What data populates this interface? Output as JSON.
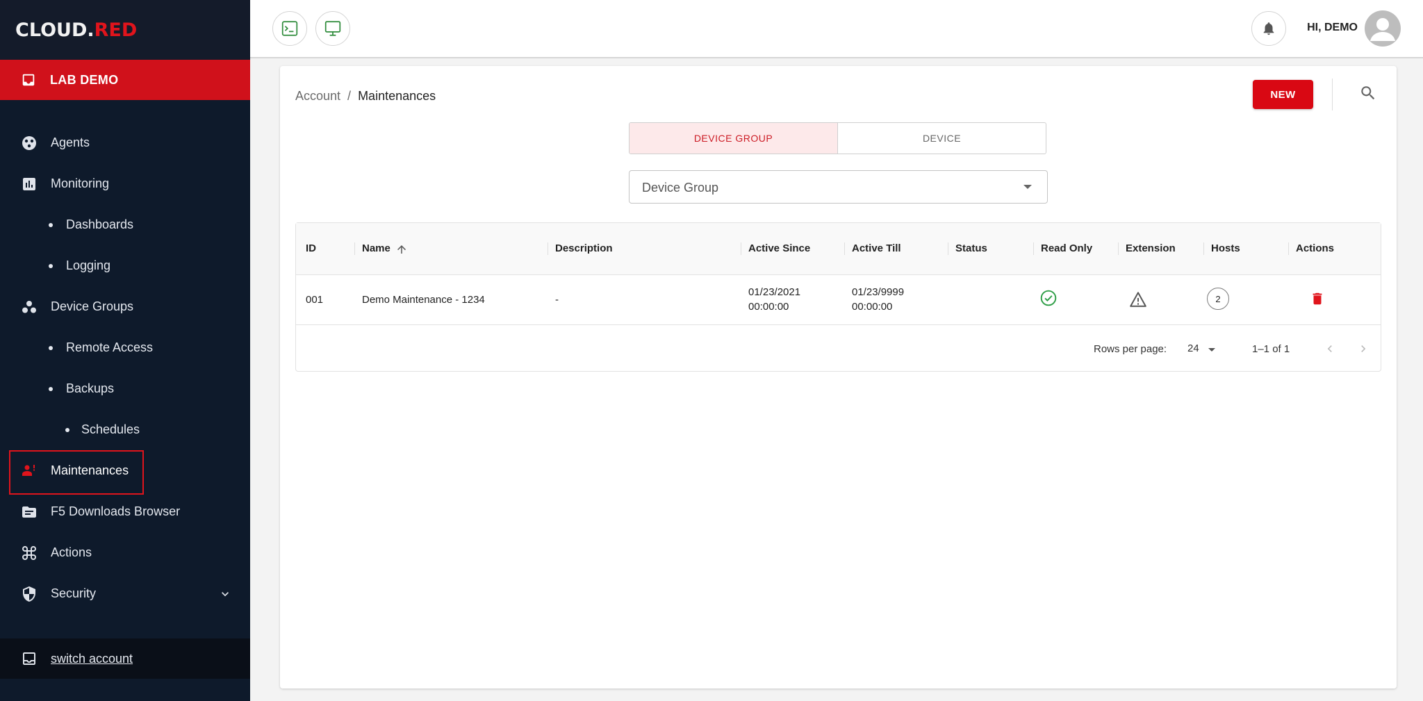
{
  "brand": {
    "logo_part1": "CL",
    "logo_o": "O",
    "logo_part2": "UD.",
    "logo_part3": "RED",
    "accent": "#d0111b"
  },
  "sidebar": {
    "account_label": "LAB DEMO",
    "items": [
      {
        "label": "Agents",
        "icon": "agents-icon",
        "level": 0
      },
      {
        "label": "Monitoring",
        "icon": "chart-icon",
        "level": 0
      },
      {
        "label": "Dashboards",
        "icon": "bullet",
        "level": 1
      },
      {
        "label": "Logging",
        "icon": "bullet",
        "level": 1
      },
      {
        "label": "Device Groups",
        "icon": "device-groups-icon",
        "level": 0
      },
      {
        "label": "Remote Access",
        "icon": "bullet",
        "level": 1
      },
      {
        "label": "Backups",
        "icon": "bullet",
        "level": 1
      },
      {
        "label": "Schedules",
        "icon": "bullet",
        "level": 2
      },
      {
        "label": "Maintenances",
        "icon": "maintenance-icon",
        "level": 0,
        "selected": true
      },
      {
        "label": "F5 Downloads Browser",
        "icon": "folder-icon",
        "level": 0
      },
      {
        "label": "Actions",
        "icon": "command-icon",
        "level": 0
      },
      {
        "label": "Security",
        "icon": "shield-icon",
        "level": 0,
        "expandable": true
      }
    ],
    "switch_account": "switch account"
  },
  "topbar": {
    "greeting": "HI, DEMO",
    "terminal_icon": "terminal-icon",
    "monitor_icon": "monitor-icon",
    "bell_icon": "bell-icon"
  },
  "main": {
    "breadcrumb": {
      "root": "Account",
      "separator": "/",
      "current": "Maintenances"
    },
    "new_label": "NEW",
    "tabs": [
      {
        "label": "DEVICE GROUP",
        "active": true
      },
      {
        "label": "DEVICE",
        "active": false
      }
    ],
    "select": {
      "value": "Device Group"
    },
    "table": {
      "columns": [
        "ID",
        "Name",
        "Description",
        "Active Since",
        "Active Till",
        "Status",
        "Read Only",
        "Extension",
        "Hosts",
        "Actions"
      ],
      "rows": [
        {
          "id": "001",
          "name": "Demo Maintenance - 1234",
          "description": "-",
          "active_since_date": "01/23/2021",
          "active_since_time": "00:00:00",
          "active_till_date": "01/23/9999",
          "active_till_time": "00:00:00",
          "status": "",
          "read_only_icon": "check-circle-icon",
          "extension_icon": "warning-icon",
          "hosts": "2",
          "action_icon": "delete-icon"
        }
      ]
    },
    "pagination": {
      "rows_per_page_label": "Rows per page:",
      "rows_per_page": "24",
      "range": "1–1 of 1"
    }
  }
}
